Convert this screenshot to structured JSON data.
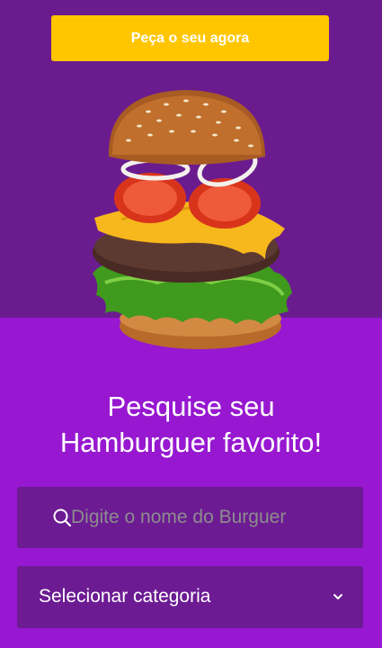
{
  "hero": {
    "cta_label": "Peça o seu agora",
    "image_icon": "burger-image"
  },
  "heading": {
    "line1": "Pesquise seu",
    "line2": "Hamburguer favorito!"
  },
  "search": {
    "placeholder": "Digite o nome do Burguer",
    "value": "",
    "icon": "search-icon"
  },
  "category_select": {
    "selected": "Selecionar categoria",
    "icon": "chevron-down-icon"
  },
  "colors": {
    "hero_bg": "#6a1c8f",
    "page_bg": "#9718d0",
    "cta_bg": "#ffc600",
    "field_bg": "#6c1b93"
  }
}
